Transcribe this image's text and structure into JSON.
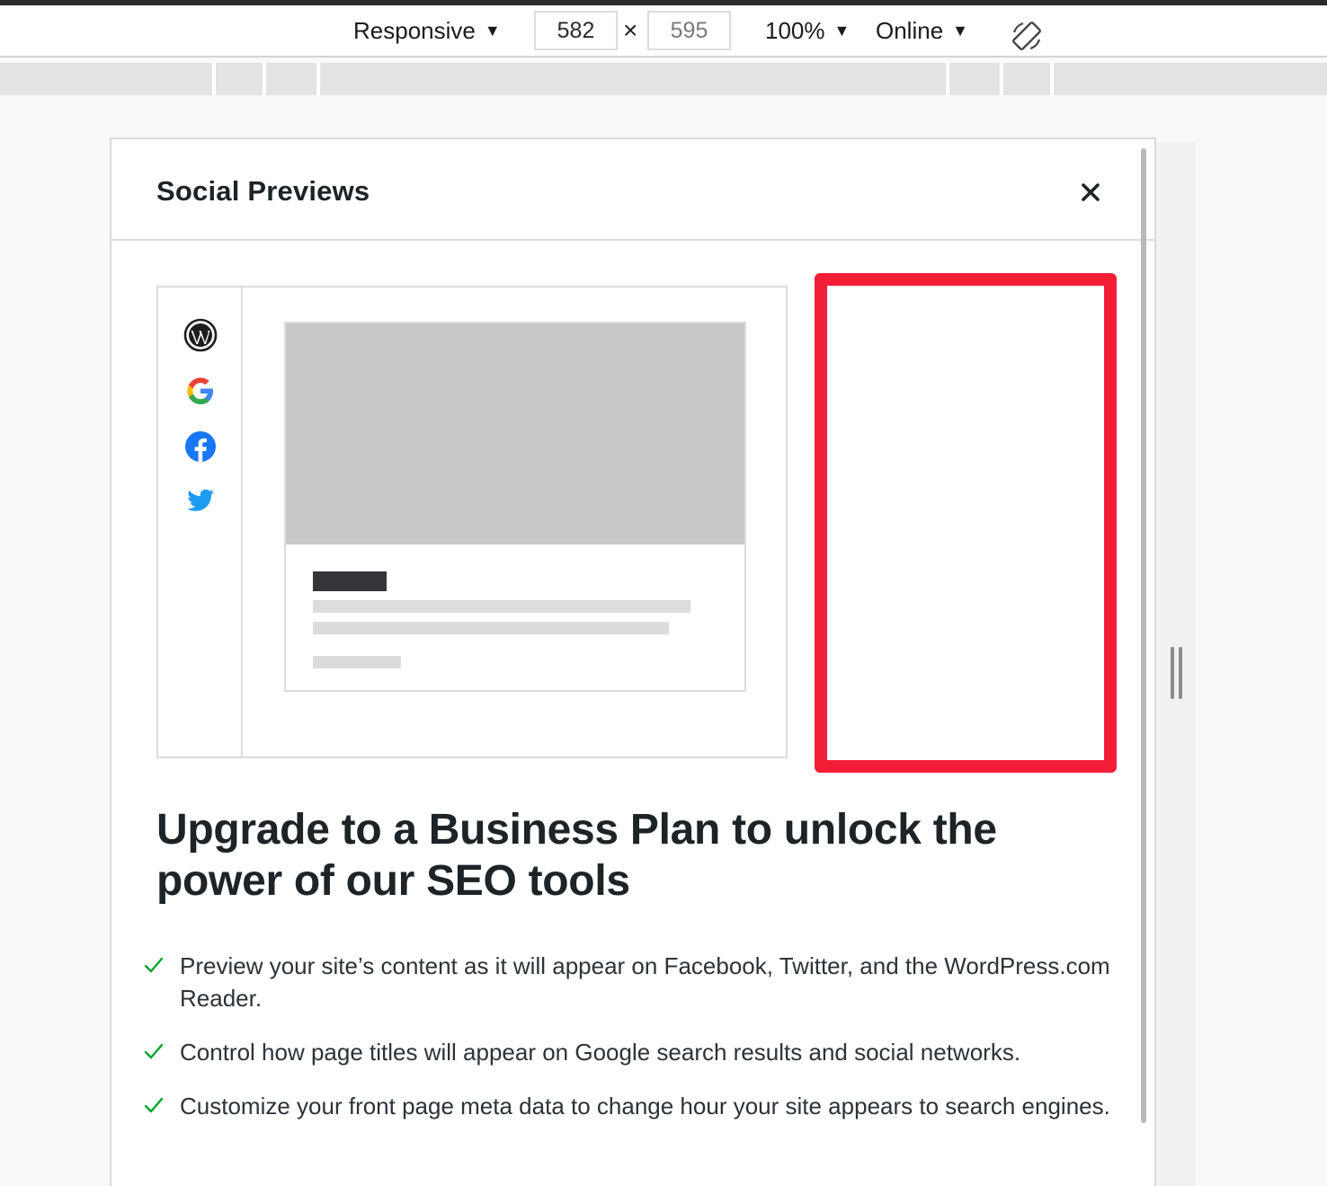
{
  "devtools_toolbar": {
    "device_mode": "Responsive",
    "width_value": "582",
    "height_value": "595",
    "dimension_separator": "×",
    "zoom": "100%",
    "network": "Online",
    "rotate_icon": "rotate-device-icon"
  },
  "modal": {
    "title": "Social Previews",
    "close_icon": "close-icon",
    "networks": [
      "wordpress-icon",
      "google-icon",
      "facebook-icon",
      "twitter-icon"
    ],
    "headline": "Upgrade to a Business Plan to unlock the power of our SEO tools",
    "features": [
      "Preview your site’s content as it will appear on Facebook, Twitter, and the WordPress.com Reader.",
      "Control how page titles will appear on Google search results and social networks.",
      "Customize your front page meta data to change hour your site appears to search engines."
    ]
  },
  "colors": {
    "highlight_border": "#f21e36",
    "check_green": "#00a32a",
    "facebook_blue": "#1877f2",
    "twitter_blue": "#1d9bf0",
    "placeholder_gray": "#c9c9cc"
  }
}
